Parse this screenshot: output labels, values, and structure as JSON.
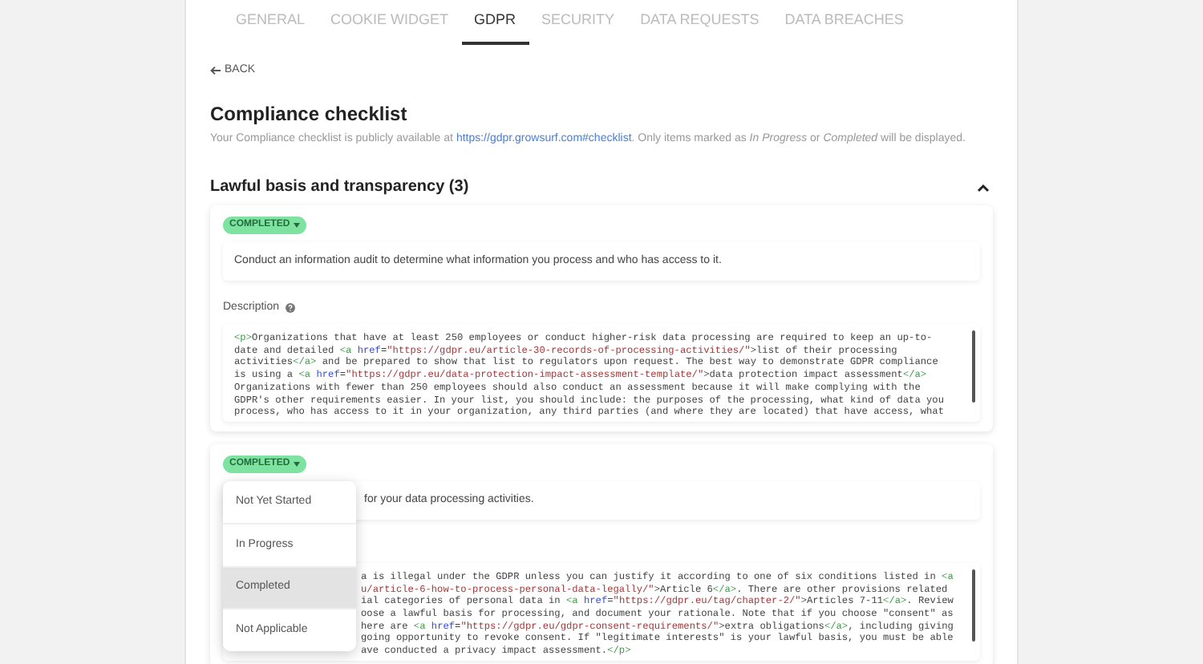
{
  "tabs": [
    {
      "label": "GENERAL",
      "selected": false
    },
    {
      "label": "COOKIE WIDGET",
      "selected": false
    },
    {
      "label": "GDPR",
      "selected": true
    },
    {
      "label": "SECURITY",
      "selected": false
    },
    {
      "label": "DATA REQUESTS",
      "selected": false
    },
    {
      "label": "DATA BREACHES",
      "selected": false
    }
  ],
  "back": {
    "label": "BACK"
  },
  "title": "Compliance checklist",
  "subtitle": {
    "before": "Your Compliance checklist is publicly available at ",
    "link": "https://gdpr.growsurf.com#checklist",
    "after": ". Only items marked as *In Progress* or *Completed* will be displayed."
  },
  "section": {
    "title": "Lawful basis and transparency (3)",
    "expanded": true,
    "items": [
      {
        "status": "COMPLETED",
        "menu_open": false,
        "task": "Conduct an information audit to determine what information you process and who has access to it.",
        "description_label": "Description",
        "code_lines": [
          [
            {
              "kind": "tag",
              "text": "<p>"
            },
            {
              "kind": "text",
              "text": "Organizations that have at least 250 employees or conduct higher-risk data processing are required to keep an up-to-"
            }
          ],
          [
            {
              "kind": "text",
              "text": "date and detailed "
            },
            {
              "kind": "tag",
              "text": "<a "
            },
            {
              "kind": "attr",
              "text": "href"
            },
            {
              "kind": "text",
              "text": "="
            },
            {
              "kind": "string",
              "text": "\"https://gdpr.eu/article-30-records-of-processing-activities/\""
            },
            {
              "kind": "text",
              "text": ">list of their processing"
            }
          ],
          [
            {
              "kind": "text",
              "text": "activities"
            },
            {
              "kind": "tag",
              "text": "</a>"
            },
            {
              "kind": "text",
              "text": " and be prepared to show that list to regulators upon request. The best way to demonstrate GDPR compliance"
            }
          ],
          [
            {
              "kind": "text",
              "text": "is using a "
            },
            {
              "kind": "tag",
              "text": "<a "
            },
            {
              "kind": "attr",
              "text": "href"
            },
            {
              "kind": "text",
              "text": "="
            },
            {
              "kind": "string",
              "text": "\"https://gdpr.eu/data-protection-impact-assessment-template/\""
            },
            {
              "kind": "text",
              "text": ">data protection impact assessment"
            },
            {
              "kind": "tag",
              "text": "</a>"
            }
          ],
          [
            {
              "kind": "text",
              "text": "Organizations with fewer than 250 employees should also conduct an assessment because it will make complying with the"
            }
          ],
          [
            {
              "kind": "text",
              "text": "GDPR's other requirements easier. In your list, you should include: the purposes of the processing, what kind of data you"
            }
          ],
          [
            {
              "kind": "text",
              "text": "process, who has access to it in your organization, any third parties (and where they are located) that have access, what"
            }
          ]
        ]
      },
      {
        "status": "COMPLETED",
        "menu_open": true,
        "menu": [
          {
            "label": "Not Yet Started",
            "selected": false
          },
          {
            "label": "In Progress",
            "selected": false
          },
          {
            "label": "Completed",
            "selected": true
          },
          {
            "label": "Not Applicable",
            "selected": false
          }
        ],
        "task": "for your data processing activities.",
        "code_lines": [
          [
            {
              "kind": "text",
              "text": "a is illegal under the GDPR unless you can justify it according to one of six conditions listed in "
            },
            {
              "kind": "tag",
              "text": "<a"
            }
          ],
          [
            {
              "kind": "string",
              "text": "u/article-6-how-to-process-personal-data-legally/\""
            },
            {
              "kind": "text",
              "text": ">Article 6"
            },
            {
              "kind": "tag",
              "text": "</a>"
            },
            {
              "kind": "text",
              "text": ". There are other provisions related"
            }
          ],
          [
            {
              "kind": "text",
              "text": "ial categories of personal data in "
            },
            {
              "kind": "tag",
              "text": "<a "
            },
            {
              "kind": "attr",
              "text": "href"
            },
            {
              "kind": "text",
              "text": "="
            },
            {
              "kind": "string",
              "text": "\"https://gdpr.eu/tag/chapter-2/\""
            },
            {
              "kind": "text",
              "text": ">Articles 7-11"
            },
            {
              "kind": "tag",
              "text": "</a>"
            },
            {
              "kind": "text",
              "text": ". Review"
            }
          ],
          [
            {
              "kind": "text",
              "text": "oose a lawful basis for processing, and document your rationale. Note that if you choose \"consent\" as"
            }
          ],
          [
            {
              "kind": "text",
              "text": "here are "
            },
            {
              "kind": "tag",
              "text": "<a "
            },
            {
              "kind": "attr",
              "text": "href"
            },
            {
              "kind": "text",
              "text": "="
            },
            {
              "kind": "string",
              "text": "\"https://gdpr.eu/gdpr-consent-requirements/\""
            },
            {
              "kind": "text",
              "text": ">extra obligations"
            },
            {
              "kind": "tag",
              "text": "</a>"
            },
            {
              "kind": "text",
              "text": ", including giving"
            }
          ],
          [
            {
              "kind": "text",
              "text": "going opportunity to revoke consent. If \"legitimate interests\" is your lawful basis, you must be able"
            }
          ],
          [
            {
              "kind": "text",
              "text": "ave conducted a privacy impact assessment."
            },
            {
              "kind": "tag",
              "text": "</p>"
            }
          ]
        ]
      }
    ]
  }
}
